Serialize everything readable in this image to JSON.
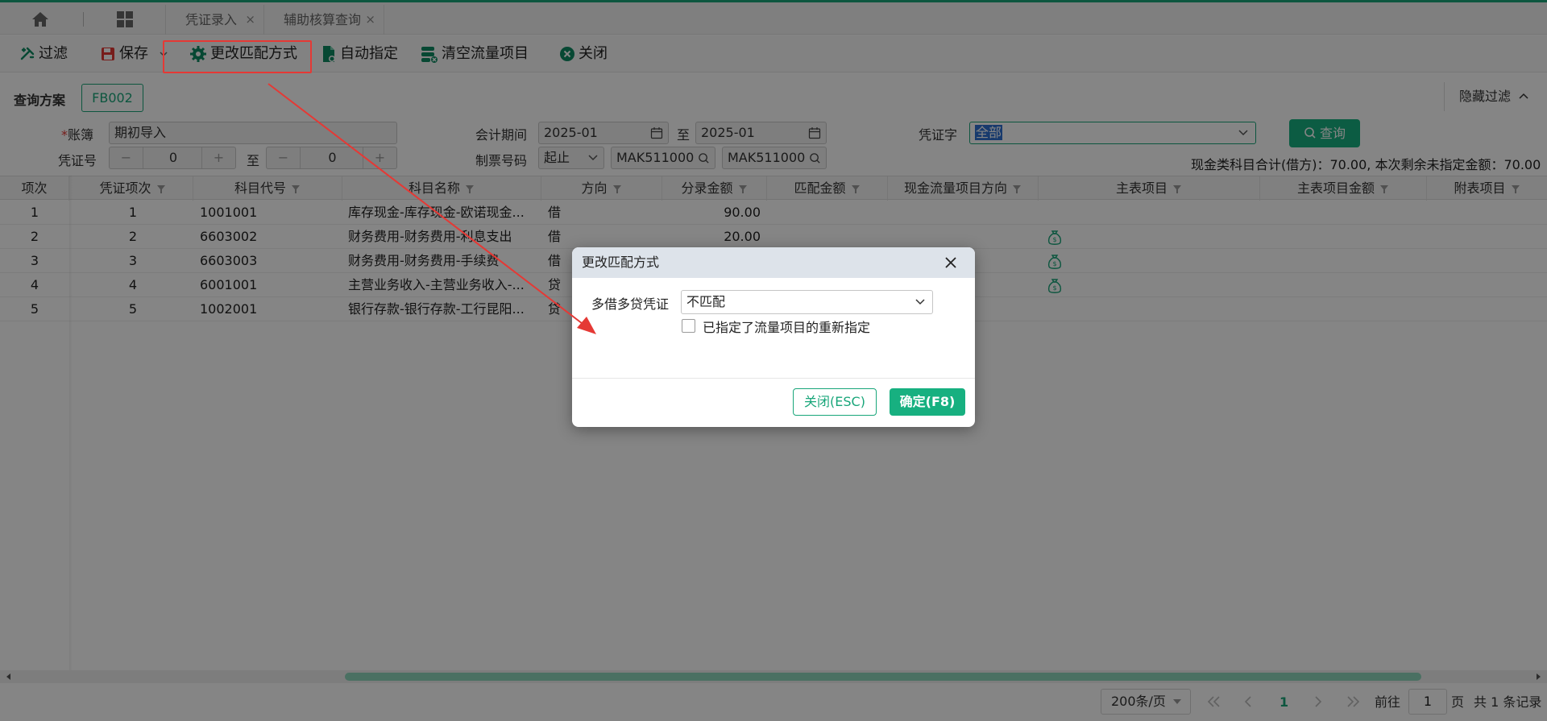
{
  "tabs": [
    {
      "label": "凭证录入"
    },
    {
      "label": "辅助核算查询"
    }
  ],
  "tab_close_glyph": "×",
  "toolbar": {
    "filter": "过滤",
    "save": "保存",
    "change_match": "更改匹配方式",
    "auto_assign": "自动指定",
    "clear_flow": "清空流量项目",
    "close": "关闭"
  },
  "filter": {
    "scheme_label": "查询方案",
    "scheme_value": "FB002",
    "hide_filter": "隐藏过滤",
    "ledger_label": "账簿",
    "ledger_value": "期初导入",
    "period_label": "会计期间",
    "period_from": "2025-01",
    "period_to_label": "至",
    "period_to": "2025-01",
    "voucher_word_label": "凭证字",
    "voucher_word_value": "全部",
    "search_button": "查询",
    "voucher_no_label": "凭证号",
    "voucher_no_from": "0",
    "voucher_no_to_label": "至",
    "voucher_no_to": "0",
    "minus": "−",
    "plus": "+",
    "ticket_label": "制票号码",
    "ticket_mode": "起止",
    "ticket_from": "MAK511000",
    "ticket_to": "MAK511000",
    "summary": "现金类科目合计(借方)：70.00, 本次剩余未指定金额：70.00"
  },
  "grid": {
    "headers": [
      "项次",
      "凭证项次",
      "科目代号",
      "科目名称",
      "方向",
      "分录金额",
      "匹配金额",
      "现金流量项目方向",
      "主表项目",
      "主表项目金额",
      "附表项目"
    ],
    "rows": [
      {
        "idx": "1",
        "entry": "1",
        "code": "1001001",
        "name": "库存现金-库存现金-欧诺现金...",
        "dir": "借",
        "amount": "90.00"
      },
      {
        "idx": "2",
        "entry": "2",
        "code": "6603002",
        "name": "财务费用-财务费用-利息支出",
        "dir": "借",
        "amount": "20.00"
      },
      {
        "idx": "3",
        "entry": "3",
        "code": "6603003",
        "name": "财务费用-财务费用-手续费",
        "dir": "借",
        "amount": ""
      },
      {
        "idx": "4",
        "entry": "4",
        "code": "6001001",
        "name": "主营业务收入-主营业务收入-...",
        "dir": "贷",
        "amount": ""
      },
      {
        "idx": "5",
        "entry": "5",
        "code": "1002001",
        "name": "银行存款-银行存款-工行昆阳...",
        "dir": "贷",
        "amount": ""
      }
    ]
  },
  "pager": {
    "page_size": "200条/页",
    "current_page": "1",
    "goto_label": "前往",
    "goto_value": "1",
    "page_unit": "页",
    "total": "共 1 条记录"
  },
  "dialog": {
    "title": "更改匹配方式",
    "field_label": "多借多贷凭证",
    "field_value": "不匹配",
    "checkbox_label": "已指定了流量项目的重新指定",
    "close_button": "关闭(ESC)",
    "ok_button": "确定(F8)"
  },
  "colors": {
    "accent": "#17b080",
    "highlight": "#e53935"
  }
}
